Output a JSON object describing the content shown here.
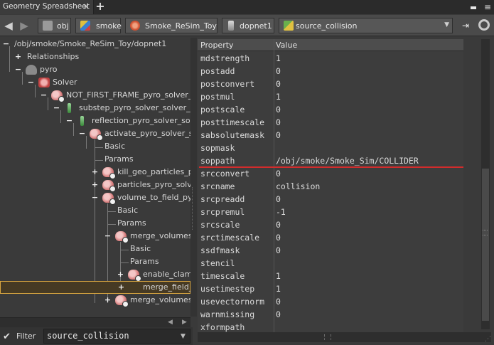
{
  "tab": {
    "title": "Geometry Spreadsheet",
    "close_glyph": "×",
    "add_glyph": "+"
  },
  "window": {
    "menu_glyph": "≡"
  },
  "pathbar": {
    "crumbs": [
      "obj",
      "smoke",
      "Smoke_ReSim_Toy",
      "dopnet1",
      "source_collision"
    ]
  },
  "tree": {
    "root": "/obj/smoke/Smoke_ReSim_Toy/dopnet1",
    "items": [
      "Relationships",
      "pyro",
      "Solver",
      "NOT_FIRST_FRAME_pyro_solver_sc",
      "substep_pyro_solver_solver_m",
      "reflection_pyro_solver_solv",
      "activate_pyro_solver_sc",
      "Basic",
      "Params",
      "kill_geo_particles_py",
      "particles_pyro_solve",
      "volume_to_field_pyr",
      "Basic",
      "Params",
      "merge_volumes_",
      "Basic",
      "Params",
      "enable_clam",
      "merge_field_",
      "merge_volumes_"
    ]
  },
  "filter": {
    "label": "Filter",
    "value": "source_collision"
  },
  "sheet": {
    "headers": [
      "Property",
      "Value"
    ],
    "rows": [
      {
        "p": "mdstrength",
        "v": "1"
      },
      {
        "p": "postadd",
        "v": "0"
      },
      {
        "p": "postconvert",
        "v": "0"
      },
      {
        "p": "postmul",
        "v": "1"
      },
      {
        "p": "postscale",
        "v": "0"
      },
      {
        "p": "posttimescale",
        "v": "0"
      },
      {
        "p": "sabsolutemask",
        "v": "0"
      },
      {
        "p": "sopmask",
        "v": ""
      },
      {
        "p": "soppath",
        "v": "/obj/smoke/Smoke_Sim/COLLIDER"
      },
      {
        "p": "srcconvert",
        "v": "0"
      },
      {
        "p": "srcname",
        "v": "collision"
      },
      {
        "p": "srcpreadd",
        "v": "0"
      },
      {
        "p": "srcpremul",
        "v": "-1"
      },
      {
        "p": "srcscale",
        "v": "0"
      },
      {
        "p": "srctimescale",
        "v": "0"
      },
      {
        "p": "ssdfmask",
        "v": "0"
      },
      {
        "p": "stencil",
        "v": ""
      },
      {
        "p": "timescale",
        "v": "1"
      },
      {
        "p": "usetimestep",
        "v": "1"
      },
      {
        "p": "usevectornorm",
        "v": "0"
      },
      {
        "p": "warnmissing",
        "v": "0"
      },
      {
        "p": "xformpath",
        "v": ""
      }
    ]
  },
  "colors": {
    "highlight_border": "#d9a640",
    "annotation_red": "#d22c2c"
  }
}
